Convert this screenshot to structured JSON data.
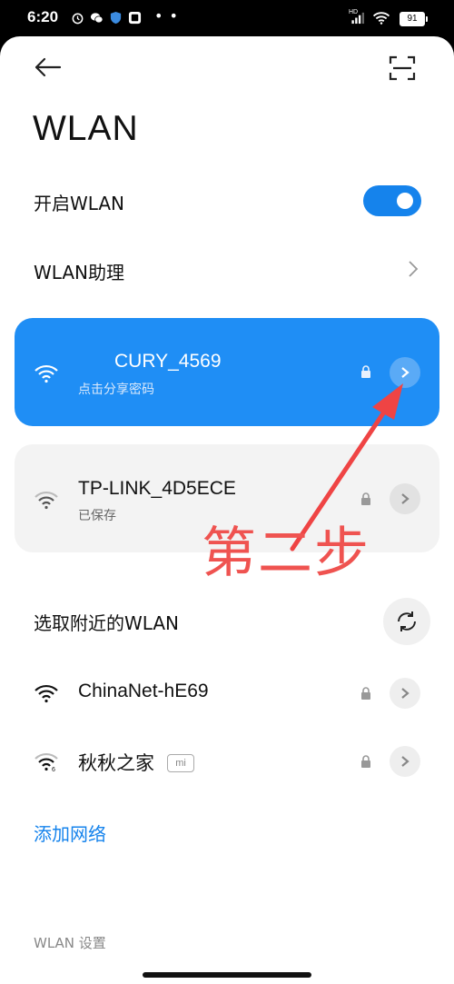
{
  "status_bar": {
    "time": "6:20",
    "battery": "91",
    "network_badge": "HD",
    "dots": "• •",
    "icons": [
      "alarm-icon",
      "wechat-icon",
      "shield-icon",
      "app-icon",
      "signal-icon",
      "wifi-icon",
      "battery-icon"
    ]
  },
  "header": {
    "title": "WLAN",
    "back_icon": "back-arrow-icon",
    "scan_icon": "scan-icon"
  },
  "toggle_row": {
    "label": "开启WLAN",
    "enabled": true
  },
  "assistant_row": {
    "label": "WLAN助理"
  },
  "connected_network": {
    "name": "CURY_4569",
    "subtitle": "点击分享密码",
    "secured": true
  },
  "saved_network": {
    "name": "TP-LINK_4D5ECE",
    "subtitle": "已保存",
    "secured": true
  },
  "nearby": {
    "section_label": "选取附近的WLAN",
    "networks": [
      {
        "name": "ChinaNet-hE69",
        "secured": true,
        "badge": ""
      },
      {
        "name": "秋秋之家",
        "secured": true,
        "badge": "mi"
      }
    ]
  },
  "add_network_label": "添加网络",
  "settings_label": "WLAN 设置",
  "annotation": {
    "text": "第二步",
    "color": "#ef5350"
  },
  "colors": {
    "accent": "#1583ec",
    "active_card": "#1f8ef5",
    "saved_card": "#f3f3f3"
  }
}
